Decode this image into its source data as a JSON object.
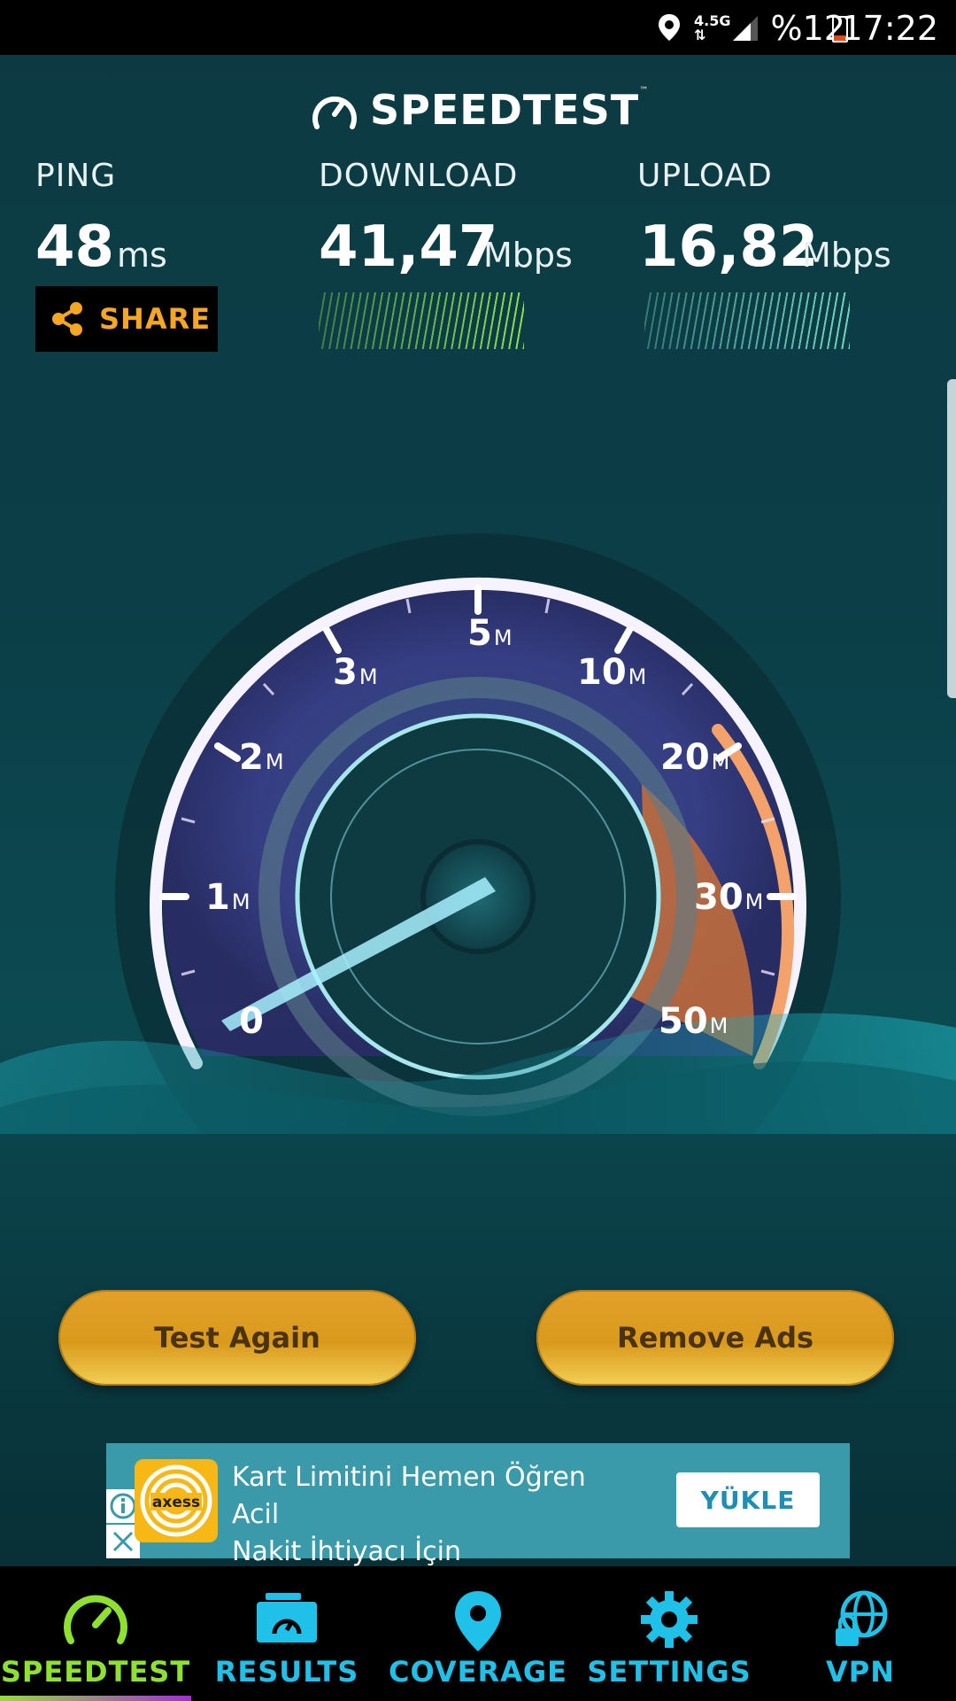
{
  "status_bar": {
    "time": "17:22",
    "battery_percent": "%12",
    "network": "4.5G"
  },
  "app": {
    "logo_text": "SPEEDTEST",
    "logo_mark": "™"
  },
  "metrics": {
    "ping": {
      "label": "PING",
      "value": "48",
      "unit": "ms"
    },
    "download": {
      "label": "DOWNLOAD",
      "value": "41,47",
      "unit": "Mbps"
    },
    "upload": {
      "label": "UPLOAD",
      "value": "16,82",
      "unit": "Mbps"
    }
  },
  "share": {
    "label": "SHARE"
  },
  "gauge": {
    "ticks": [
      {
        "value": "0",
        "unit": ""
      },
      {
        "value": "1",
        "unit": "M"
      },
      {
        "value": "2",
        "unit": "M"
      },
      {
        "value": "3",
        "unit": "M"
      },
      {
        "value": "5",
        "unit": "M"
      },
      {
        "value": "10",
        "unit": "M"
      },
      {
        "value": "20",
        "unit": "M"
      },
      {
        "value": "30",
        "unit": "M"
      },
      {
        "value": "50",
        "unit": "M"
      }
    ],
    "colors": {
      "ring": "#f4ecff",
      "accent": "#e8873a",
      "needle": "#8fe6ff"
    }
  },
  "buttons": {
    "test_again": "Test Again",
    "remove_ads": "Remove Ads"
  },
  "ad": {
    "line1": "Kart Limitini Hemen Öğren Acil",
    "line2": "Nakit İhtiyacı İçin",
    "cta": "YÜKLE",
    "brand": "axess"
  },
  "nav": {
    "items": [
      {
        "label": "SPEEDTEST",
        "icon": "gauge-icon",
        "active": true
      },
      {
        "label": "RESULTS",
        "icon": "results-folder-icon",
        "active": false
      },
      {
        "label": "COVERAGE",
        "icon": "location-pin-icon",
        "active": false
      },
      {
        "label": "SETTINGS",
        "icon": "gear-icon",
        "active": false
      },
      {
        "label": "VPN",
        "icon": "globe-lock-icon",
        "active": false
      }
    ]
  }
}
